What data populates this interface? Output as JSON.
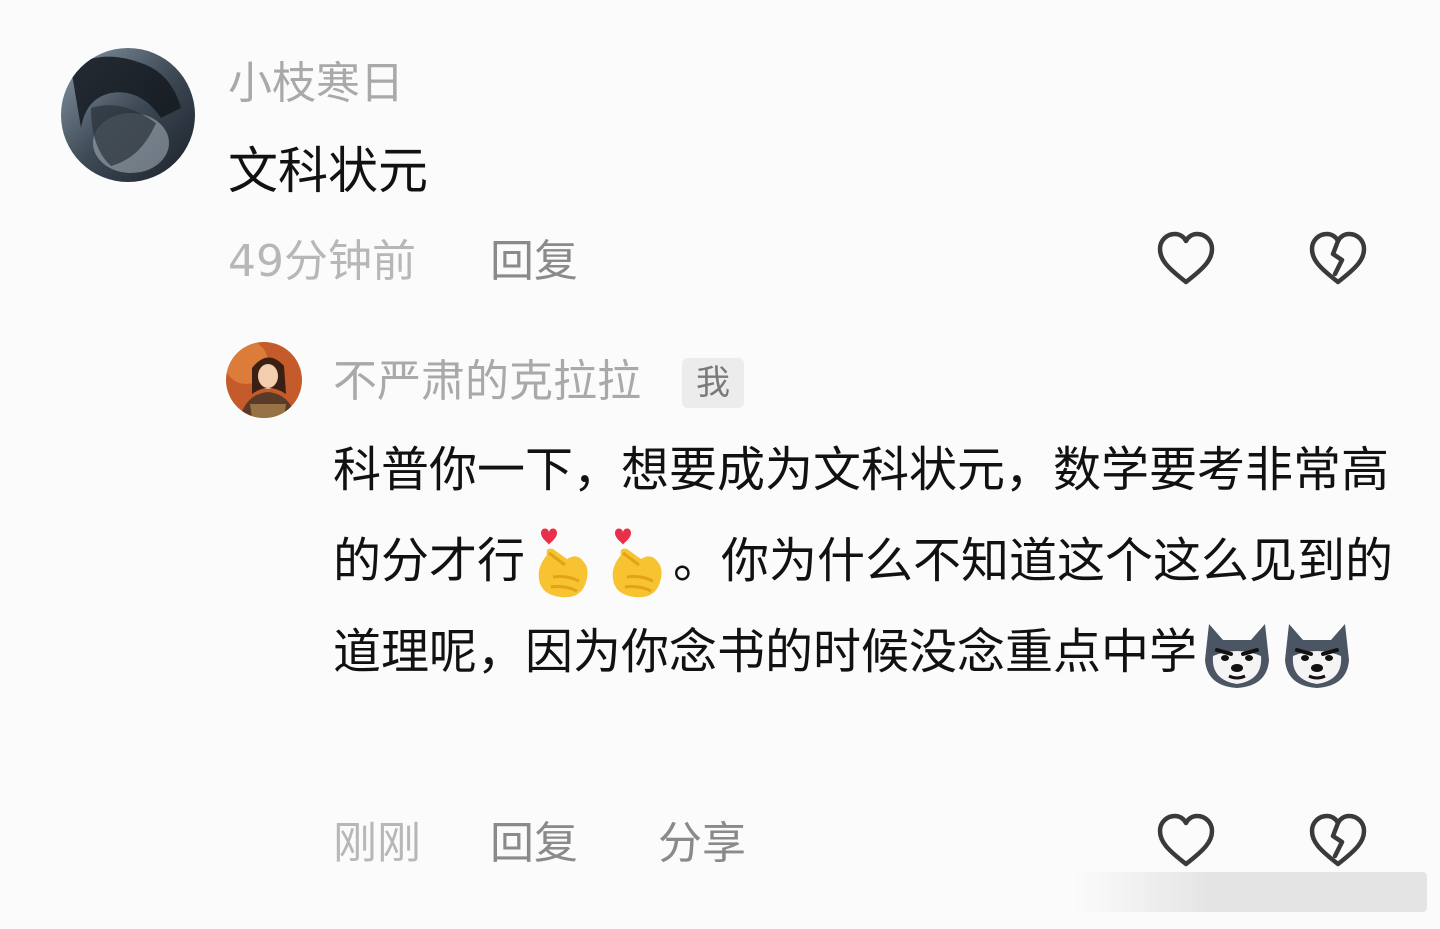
{
  "comments": [
    {
      "username": "小枝寒日",
      "text": "文科状元",
      "time": "49分钟前",
      "reply_label": "回复",
      "like_icon": "heart-outline-icon",
      "dislike_icon": "broken-heart-icon"
    }
  ],
  "reply": {
    "username": "不严肃的克拉拉",
    "badge": "我",
    "text_part1": "科普你一下，想要成为文科状元，数学要考非常高的分才行",
    "emoji1": "finger-heart-icon",
    "text_part2": "。你为什么不知道这个这么见到的道理呢，因为你念书的时候没念重点中学",
    "emoji2": "husky-dog-icon",
    "time": "刚刚",
    "reply_label": "回复",
    "share_label": "分享",
    "like_icon": "heart-outline-icon",
    "dislike_icon": "broken-heart-icon"
  },
  "colors": {
    "background": "#fbfbfb",
    "username": "#a9a9a9",
    "text": "#111111",
    "meta": "#8a8a8a",
    "icon_stroke": "#3a3a3a"
  }
}
